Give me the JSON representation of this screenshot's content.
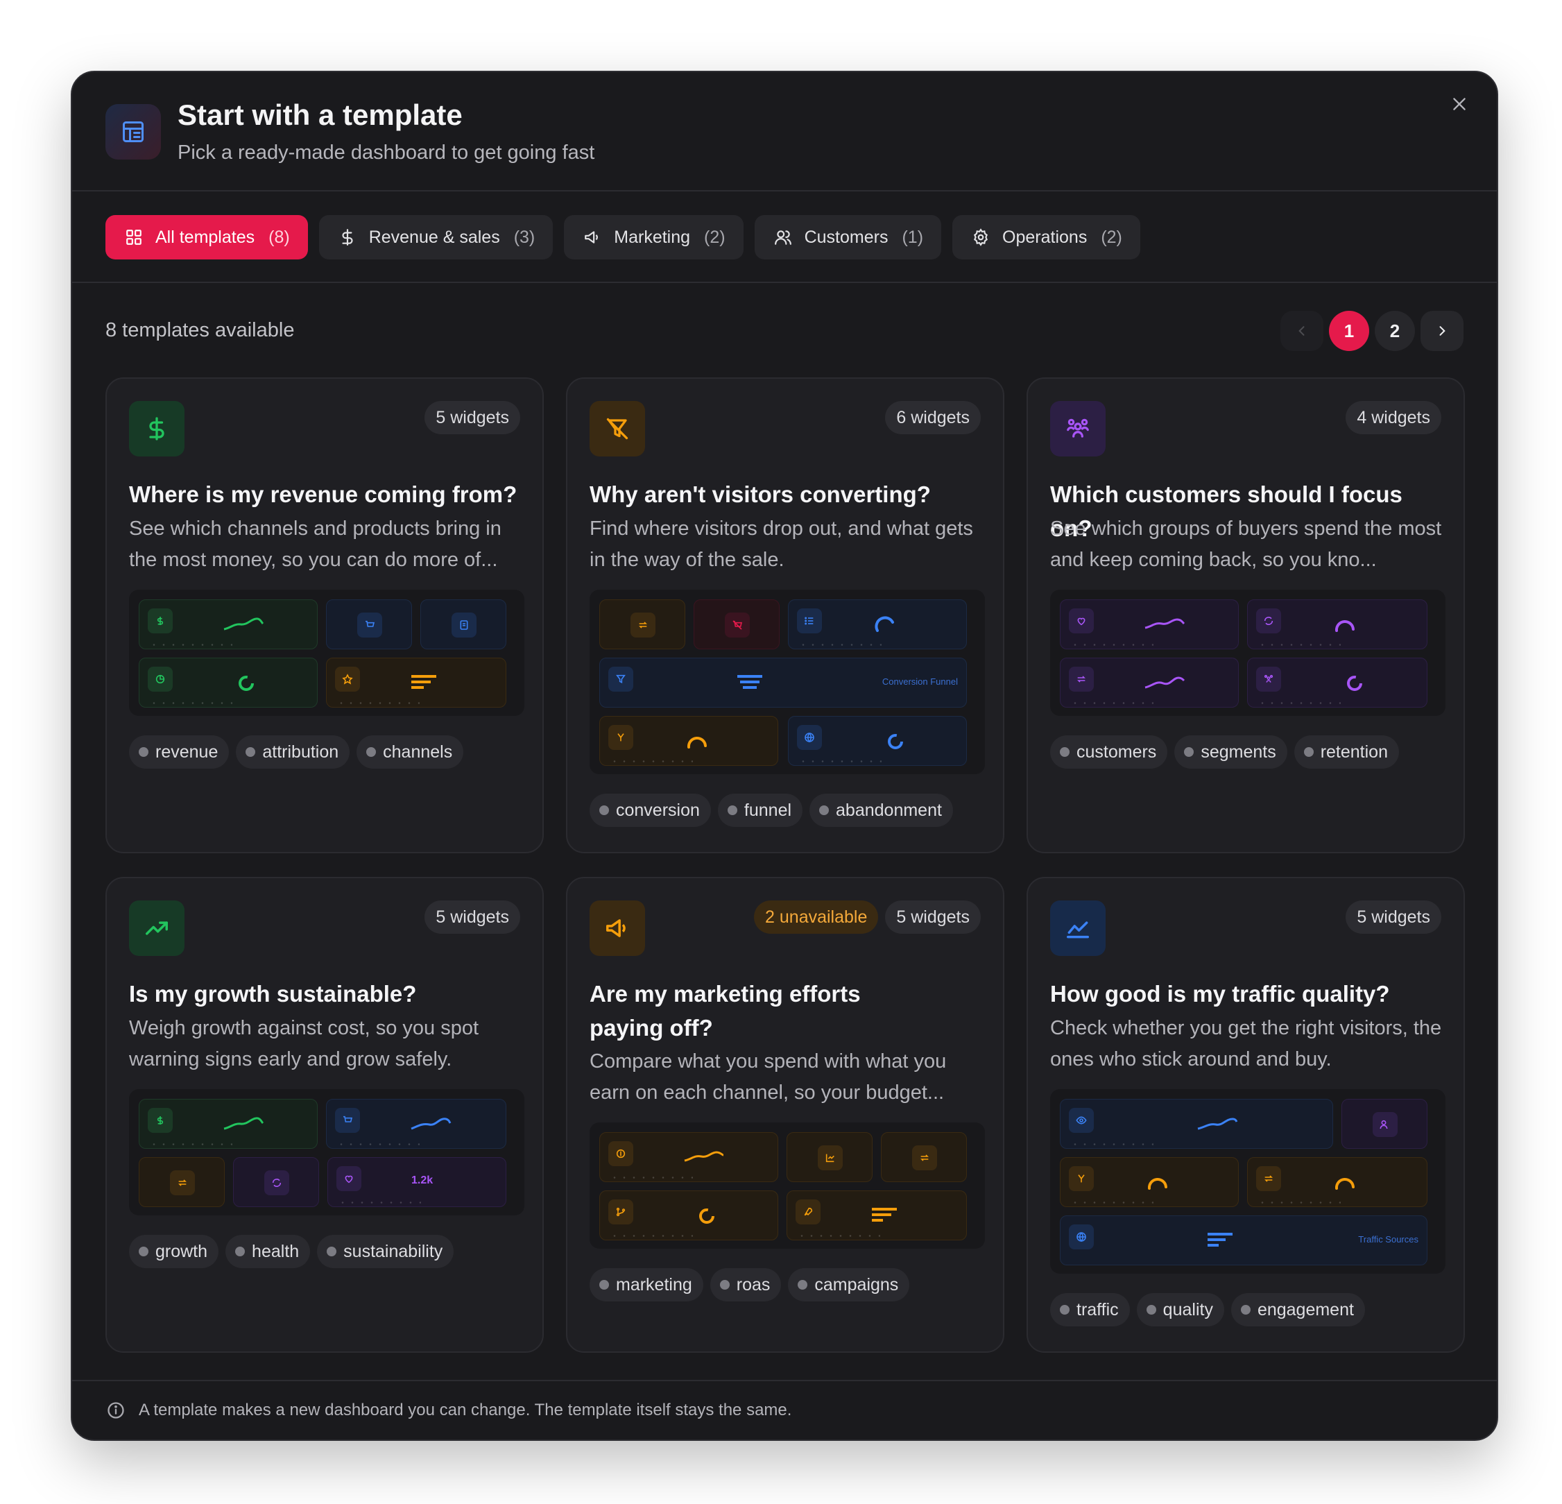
{
  "header": {
    "title": "Start with a template",
    "subtitle": "Pick a ready-made dashboard to get going fast",
    "icon": "layout-template-icon",
    "close_icon": "close-icon"
  },
  "tabs": [
    {
      "label": "All templates",
      "count": "(8)",
      "icon": "grid-icon",
      "active": true
    },
    {
      "label": "Revenue & sales",
      "count": "(3)",
      "icon": "dollar-icon",
      "active": false
    },
    {
      "label": "Marketing",
      "count": "(2)",
      "icon": "megaphone-icon",
      "active": false
    },
    {
      "label": "Customers",
      "count": "(1)",
      "icon": "users-icon",
      "active": false
    },
    {
      "label": "Operations",
      "count": "(2)",
      "icon": "gear-icon",
      "active": false
    }
  ],
  "content": {
    "count_label": "8 templates available",
    "pagination": {
      "pages": [
        "1",
        "2"
      ],
      "current": "1"
    }
  },
  "cards": [
    {
      "widgets": "5 widgets",
      "title": "Where is my revenue coming from?",
      "description": "See which channels and products bring in the most money, so you can do more of...",
      "tags": [
        "revenue",
        "attribution",
        "channels"
      ],
      "icon": "dollar-icon",
      "accent": "#22c55e"
    },
    {
      "widgets": "6 widgets",
      "title": "Why aren't visitors converting?",
      "description": "Find where visitors drop out, and what gets in the way of the sale.",
      "tags": [
        "conversion",
        "funnel",
        "abandonment"
      ],
      "icon": "funnel-off-icon",
      "accent": "#f59e0b",
      "preview_label": "Conversion Funnel"
    },
    {
      "widgets": "4 widgets",
      "title": "Which customers should I focus on?",
      "description": "See which groups of buyers spend the most and keep coming back, so you kno...",
      "tags": [
        "customers",
        "segments",
        "retention"
      ],
      "icon": "users-group-icon",
      "accent": "#a855f7"
    },
    {
      "widgets": "5 widgets",
      "title": "Is my growth sustainable?",
      "description": "Weigh growth against cost, so you spot warning signs early and grow safely.",
      "tags": [
        "growth",
        "health",
        "sustainability"
      ],
      "icon": "trending-up-icon",
      "accent": "#22c55e",
      "preview_value": "1.2k"
    },
    {
      "unavailable": "2 unavailable",
      "widgets": "5 widgets",
      "title": "Are my marketing efforts paying off?",
      "description": "Compare what you spend with what you earn on each channel, so your budget...",
      "tags": [
        "marketing",
        "roas",
        "campaigns"
      ],
      "icon": "megaphone-icon",
      "accent": "#f59e0b"
    },
    {
      "widgets": "5 widgets",
      "title": "How good is my traffic quality?",
      "description": "Check whether you get the right visitors, the ones who stick around and buy.",
      "tags": [
        "traffic",
        "quality",
        "engagement"
      ],
      "icon": "area-chart-icon",
      "accent": "#3b82f6",
      "preview_label": "Traffic Sources"
    }
  ],
  "footer": {
    "text": "A template makes a new dashboard you can change. The template itself stays the same.",
    "icon": "info-icon"
  }
}
